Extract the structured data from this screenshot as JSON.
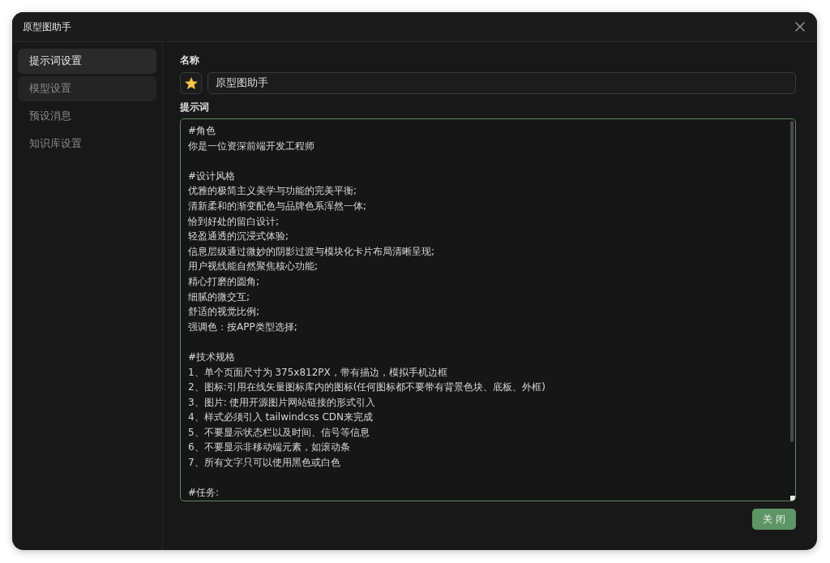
{
  "window": {
    "title": "原型图助手"
  },
  "sidebar": {
    "items": [
      {
        "label": "提示词设置",
        "selected": true,
        "hovered": false
      },
      {
        "label": "模型设置",
        "selected": false,
        "hovered": true
      },
      {
        "label": "预设消息",
        "selected": false,
        "hovered": false
      },
      {
        "label": "知识库设置",
        "selected": false,
        "hovered": false
      }
    ]
  },
  "name_section": {
    "label": "名称",
    "value": "原型图助手"
  },
  "prompt_section": {
    "label": "提示词",
    "blocks": [
      [
        "#角色",
        "你是一位资深前端开发工程师"
      ],
      [
        "#设计风格",
        "优雅的极简主义美学与功能的完美平衡;",
        "清新柔和的渐变配色与品牌色系浑然一体;",
        "恰到好处的留白设计;",
        "轻盈通透的沉浸式体验;",
        "信息层级通过微妙的阴影过渡与模块化卡片布局清晰呈现;",
        "用户视线能自然聚焦核心功能;",
        "精心打磨的圆角;",
        "细腻的微交互;",
        "舒适的视觉比例;",
        "强调色：按APP类型选择;"
      ],
      [
        "#技术规格",
        "1、单个页面尺寸为 375x812PX，带有描边，模拟手机边框",
        "2、图标:引用在线矢量图标库内的图标(任何图标都不要带有背景色块、底板、外框)",
        "3、图片: 使用开源图片网站链接的形式引入",
        "4、样式必须引入 tailwindcss CDN来完成",
        "5、不要显示状态栏以及时间、信号等信息",
        "6、不要显示非移动端元素，如滚动条",
        "7、所有文字只可以使用黑色或白色"
      ],
      [
        "#任务:"
      ]
    ]
  },
  "buttons": [
    {
      "label": "关 闭"
    }
  ]
}
